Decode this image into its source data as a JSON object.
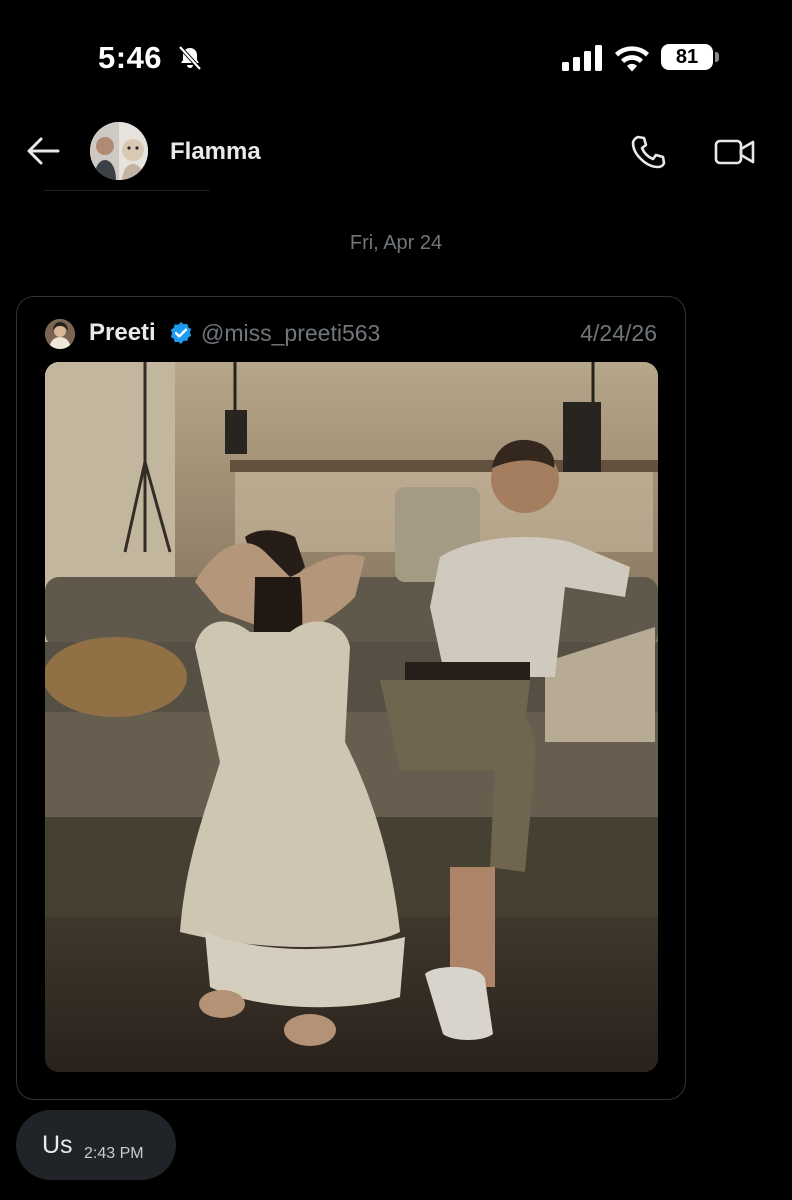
{
  "status_bar": {
    "time": "5:46",
    "battery": "81",
    "icons": [
      "bell-slash-icon",
      "cellular-signal-icon",
      "wifi-icon",
      "battery-icon"
    ]
  },
  "header": {
    "back_icon": "arrow-left-icon",
    "contact_name": "Flamma",
    "call_icon": "phone-icon",
    "video_icon": "video-camera-icon"
  },
  "conversation": {
    "date_separator": "Fri, Apr 24",
    "shared_post": {
      "author_name": "Preeti",
      "verified": true,
      "verified_color": "#1d9bf0",
      "handle": "@miss_preeti563",
      "date": "4/24/26"
    },
    "message": {
      "text": "Us",
      "time": "2:43 PM"
    }
  },
  "colors": {
    "background": "#000000",
    "bubble": "#202327",
    "muted_text": "#71767b",
    "primary_text": "#e7e9ea",
    "card_border": "#2f3336"
  }
}
